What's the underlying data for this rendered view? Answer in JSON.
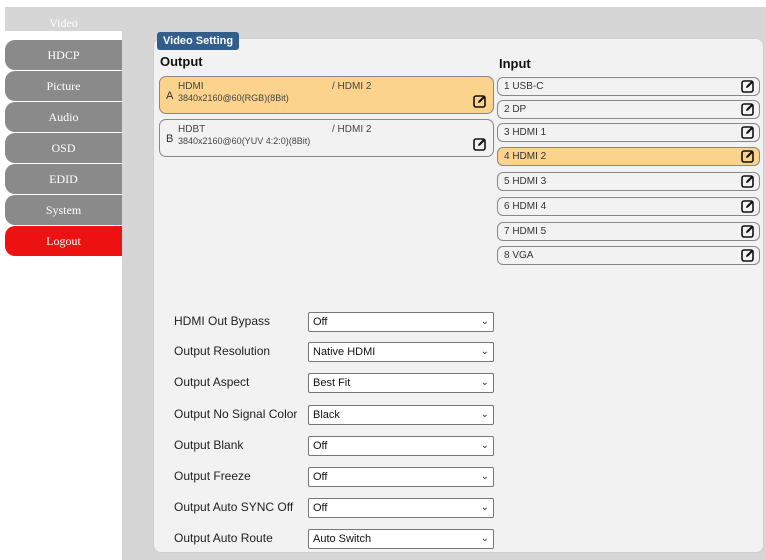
{
  "sidebar": {
    "items": [
      {
        "label": "Video"
      },
      {
        "label": "HDCP"
      },
      {
        "label": "Picture"
      },
      {
        "label": "Audio"
      },
      {
        "label": "OSD"
      },
      {
        "label": "EDID"
      },
      {
        "label": "System"
      },
      {
        "label": "Logout"
      }
    ]
  },
  "panel": {
    "title": "Video Setting",
    "output_heading": "Output",
    "input_heading": "Input"
  },
  "outputs": [
    {
      "letter": "A",
      "source": "HDMI",
      "dest": "/ HDMI 2",
      "resolution": "3840x2160@60(RGB)(8Bit)"
    },
    {
      "letter": "B",
      "source": "HDBT",
      "dest": "/ HDMI 2",
      "resolution": "3840x2160@60(YUV 4:2:0)(8Bit)"
    }
  ],
  "inputs": [
    {
      "label": "1  USB-C"
    },
    {
      "label": "2  DP"
    },
    {
      "label": "3  HDMI 1"
    },
    {
      "label": "4  HDMI 2"
    },
    {
      "label": "5  HDMI 3"
    },
    {
      "label": "6  HDMI 4"
    },
    {
      "label": "7  HDMI 5"
    },
    {
      "label": "8  VGA"
    }
  ],
  "settings": [
    {
      "label": "HDMI Out Bypass",
      "value": "Off"
    },
    {
      "label": "Output Resolution",
      "value": "Native HDMI"
    },
    {
      "label": "Output Aspect",
      "value": "Best Fit"
    },
    {
      "label": "Output No Signal Color",
      "value": "Black"
    },
    {
      "label": "Output Blank",
      "value": "Off"
    },
    {
      "label": "Output Freeze",
      "value": "Off"
    },
    {
      "label": "Output Auto SYNC Off",
      "value": "Off"
    },
    {
      "label": "Output Auto Route",
      "value": "Auto Switch"
    }
  ],
  "colors": {
    "selected": "#fbd38c",
    "nav_bg": "#8a8a8a",
    "logout": "#ee1111",
    "title_bg": "#335e8c"
  },
  "icons": {
    "edit": "edit-icon",
    "dropdown": "chevron-down-icon"
  }
}
